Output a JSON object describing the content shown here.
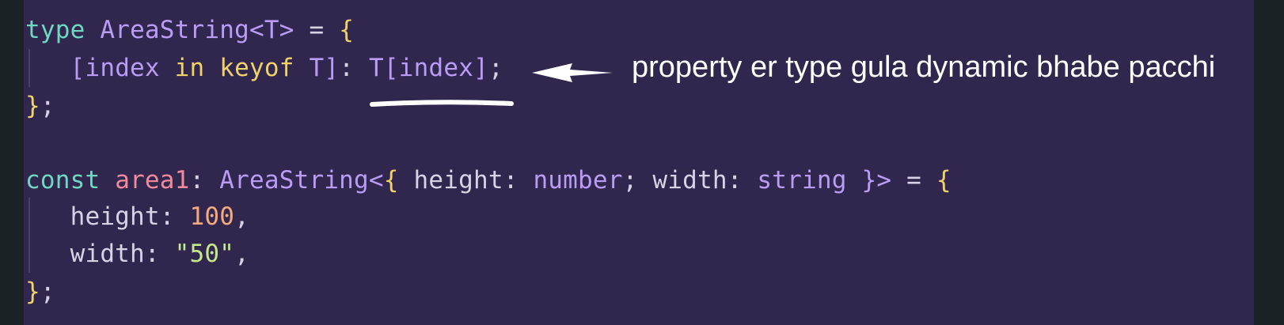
{
  "code": {
    "line1": {
      "kw": "type",
      "name": "AreaString",
      "lt": "<",
      "param": "T",
      "gt": ">",
      "eq": " = ",
      "brace": "{"
    },
    "line2": {
      "open": "[",
      "idx": "index",
      "in": "in",
      "keyof": "keyof",
      "t": "T",
      "close": "]",
      "colon": ":",
      "tref": "T",
      "open2": "[",
      "idx2": "index",
      "close2": "]",
      "semi": ";"
    },
    "line3": {
      "close": "}",
      "semi": ";"
    },
    "line5": {
      "kw": "const",
      "var": "area1",
      "colon": ": ",
      "type": "AreaString",
      "lt": "<",
      "lb": "{",
      "p1": " height",
      "c1": ": ",
      "t1": "number",
      "s1": "; ",
      "p2": "width",
      "c2": ": ",
      "t2": "string",
      "rb": " }",
      "gt": ">",
      "eq": " = ",
      "brace": "{"
    },
    "line6": {
      "prop": "height",
      "colon": ": ",
      "val": "100",
      "comma": ","
    },
    "line7": {
      "prop": "width",
      "colon": ": ",
      "val": "\"50\"",
      "comma": ","
    },
    "line8": {
      "close": "}",
      "semi": ";"
    }
  },
  "annotation": {
    "text": "property er type gula dynamic bhabe pacchi"
  },
  "colors": {
    "background": "#31264d",
    "accent_white": "#ffffff"
  }
}
